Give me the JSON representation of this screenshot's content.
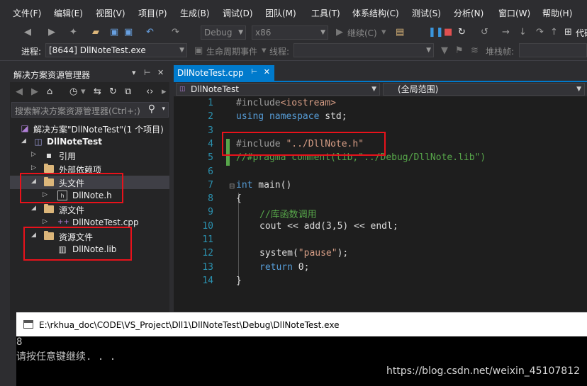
{
  "menu": [
    "文件(F)",
    "编辑(E)",
    "视图(V)",
    "项目(P)",
    "生成(B)",
    "调试(D)",
    "团队(M)",
    "工具(T)",
    "体系结构(C)",
    "测试(S)",
    "分析(N)",
    "窗口(W)",
    "帮助(H)"
  ],
  "toolbar": {
    "config": "Debug",
    "platform": "x86",
    "continue_label": "继续(C)",
    "code_label": "代码"
  },
  "debugbar": {
    "process_label": "进程:",
    "process_value": "[8644] DllNoteTest.exe",
    "lifecycle_label": "生命周期事件",
    "thread_label": "线程:",
    "stack_label": "堆栈帧:"
  },
  "explorer": {
    "title": "解决方案资源管理器",
    "search_placeholder": "搜索解决方案资源管理器(Ctrl+;)",
    "items": [
      {
        "label": "解决方案\"DllNoteTest\"(1 个项目)"
      },
      {
        "label": "DllNoteTest"
      },
      {
        "label": "引用"
      },
      {
        "label": "外部依赖项"
      },
      {
        "label": "头文件"
      },
      {
        "label": "DllNote.h"
      },
      {
        "label": "源文件"
      },
      {
        "label": "DllNoteTest.cpp"
      },
      {
        "label": "资源文件"
      },
      {
        "label": "DllNote.lib"
      }
    ]
  },
  "editor": {
    "tab": "DllNoteTest.cpp",
    "nav_project": "DllNoteTest",
    "nav_scope": "(全局范围)",
    "line_numbers": [
      "1",
      "2",
      "3",
      "4",
      "5",
      "6",
      "7",
      "8",
      "9",
      "10",
      "11",
      "12",
      "13",
      "14"
    ],
    "code": {
      "l1_pp": "#include",
      "l1_str": "<iostream>",
      "l2_kw1": "using",
      "l2_kw2": "namespace",
      "l2_rest": " std;",
      "l4_pp": "#include",
      "l4_str": "\"../DllNote.h\"",
      "l5_cm": "//#pragma comment(lib,\"../Debug/DllNote.lib\")",
      "l7_kw": "int",
      "l7_rest": " main()",
      "l8": "{",
      "l9_cm": "//库函数调用",
      "l10": "cout << add(3,5) << endl;",
      "l12_a": "system(",
      "l12_str": "\"pause\"",
      "l12_b": ");",
      "l13_kw": "return",
      "l13_rest": " 0;",
      "l14": "}"
    }
  },
  "console": {
    "title": "E:\\rkhua_doc\\CODE\\VS_Project\\Dll1\\DllNoteTest\\Debug\\DllNoteTest.exe",
    "line1": "8",
    "line2": "请按任意键继续. . .",
    "watermark": "https://blog.csdn.net/weixin_45107812"
  },
  "colors": {
    "accent": "#007acc",
    "highlight_box": "#e8121b",
    "keyword": "#569cd6",
    "string": "#d69d85",
    "comment": "#57a64a"
  }
}
